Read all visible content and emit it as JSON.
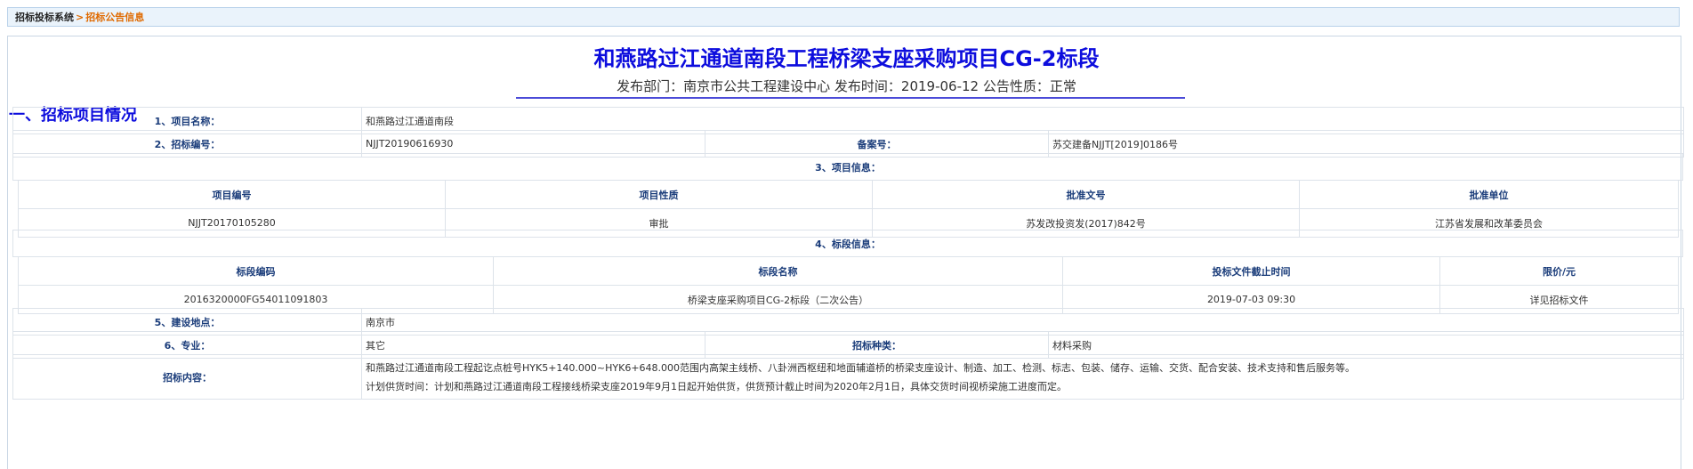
{
  "breadcrumb": {
    "home": "招标投标系统",
    "separator": ">",
    "current": "招标公告信息"
  },
  "header": {
    "title": "和燕路过江通道南段工程桥梁支座采购项目CG-2标段",
    "meta": "发布部门：南京市公共工程建设中心 发布时间：2019-06-12 公告性质：正常"
  },
  "section": {
    "heading": "一、招标项目情况"
  },
  "details": {
    "project_name_label": "1、项目名称：",
    "project_name": "和燕路过江通道南段",
    "tender_no_label": "2、招标编号：",
    "tender_no": "NJJT20190616930",
    "record_no_label": "备案号：",
    "record_no": "苏交建备NJJT[2019]0186号",
    "project_info_label": "3、项目信息：",
    "lot_info_label": "4、标段信息：",
    "location_label": "5、建设地点：",
    "location": "南京市",
    "specialty_label": "6、专业：",
    "specialty": "其它",
    "tender_type_label": "招标种类：",
    "tender_type": "材料采购",
    "content_label": "招标内容：",
    "content_line1": "和燕路过江通道南段工程起讫点桩号HYK5+140.000~HYK6+648.000范围内高架主线桥、八卦洲西枢纽和地面辅道桥的桥梁支座设计、制造、加工、检测、标志、包装、储存、运输、交货、配合安装、技术支持和售后服务等。",
    "content_line2": "计划供货时间：计划和燕路过江通道南段工程接线桥梁支座2019年9月1日起开始供货，供货预计截止时间为2020年2月1日，具体交货时间视桥梁施工进度而定。"
  },
  "project_info": {
    "headers": [
      "项目编号",
      "项目性质",
      "批准文号",
      "批准单位"
    ],
    "rows": [
      [
        "NJJT20170105280",
        "审批",
        "苏发改投资发(2017)842号",
        "江苏省发展和改革委员会"
      ]
    ]
  },
  "lot_info": {
    "headers": [
      "标段编码",
      "标段名称",
      "投标文件截止时间",
      "限价/元"
    ],
    "rows": [
      [
        "2016320000FG54011091803",
        "桥梁支座采购项目CG-2标段（二次公告）",
        "2019-07-03 09:30",
        "详见招标文件"
      ]
    ]
  }
}
